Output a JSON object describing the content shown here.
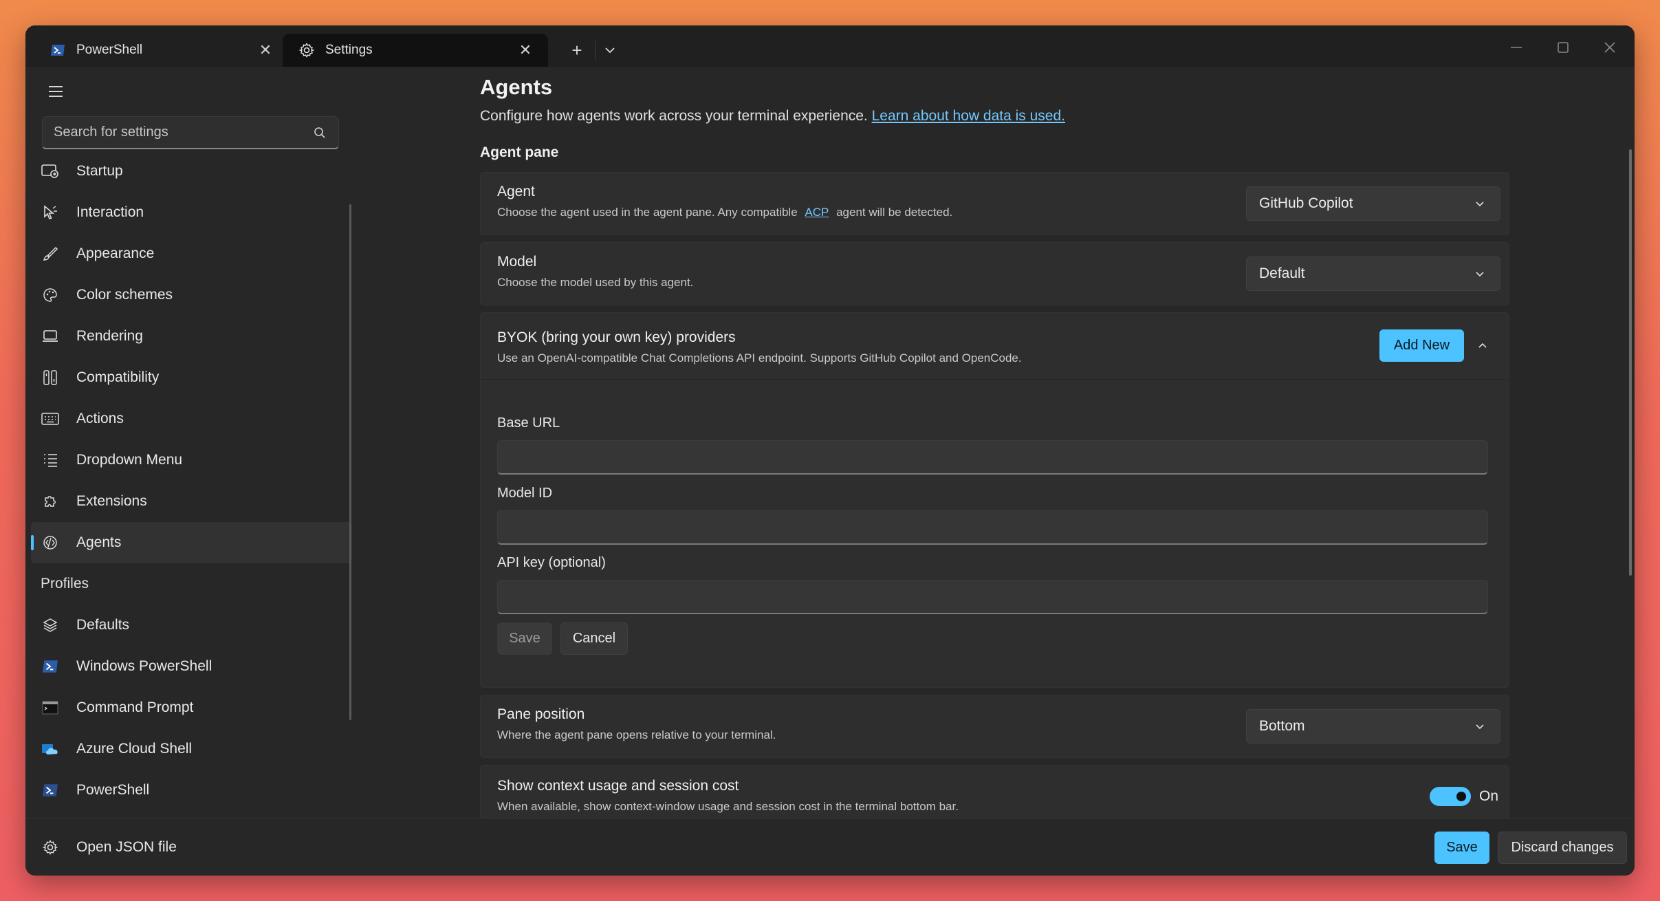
{
  "tabs": [
    {
      "label": "PowerShell",
      "icon": "powershell-icon"
    },
    {
      "label": "Settings",
      "icon": "gear-icon"
    }
  ],
  "tab_actions": {
    "new_tab": "+",
    "dropdown": "chevron-down-icon"
  },
  "window_controls": {
    "minimize": "minimize-icon",
    "maximize": "maximize-icon",
    "close": "close-icon"
  },
  "sidebar": {
    "search_placeholder": "Search for settings",
    "items": [
      {
        "label": "Startup",
        "icon": "startup-icon"
      },
      {
        "label": "Interaction",
        "icon": "cursor-icon"
      },
      {
        "label": "Appearance",
        "icon": "brush-icon"
      },
      {
        "label": "Color schemes",
        "icon": "palette-icon"
      },
      {
        "label": "Rendering",
        "icon": "monitor-icon"
      },
      {
        "label": "Compatibility",
        "icon": "compatibility-icon"
      },
      {
        "label": "Actions",
        "icon": "keyboard-icon"
      },
      {
        "label": "Dropdown Menu",
        "icon": "list-icon"
      },
      {
        "label": "Extensions",
        "icon": "puzzle-icon"
      },
      {
        "label": "Agents",
        "icon": "agent-icon",
        "active": true
      }
    ],
    "profiles_header": "Profiles",
    "profiles": [
      {
        "label": "Defaults",
        "icon": "layers-icon"
      },
      {
        "label": "Windows PowerShell",
        "icon": "powershell-icon"
      },
      {
        "label": "Command Prompt",
        "icon": "cmd-icon"
      },
      {
        "label": "Azure Cloud Shell",
        "icon": "azure-icon"
      },
      {
        "label": "PowerShell",
        "icon": "powershell-icon"
      }
    ],
    "open_json": "Open JSON file"
  },
  "main": {
    "title": "Agents",
    "description": "Configure how agents work across your terminal experience.",
    "description_link": "Learn about how data is used.",
    "section": "Agent pane",
    "agent": {
      "title": "Agent",
      "desc_before": "Choose the agent used in the agent pane. Any compatible",
      "desc_link": "ACP",
      "desc_after": "agent will be detected.",
      "value": "GitHub Copilot"
    },
    "model": {
      "title": "Model",
      "desc": "Choose the model used by this agent.",
      "value": "Default"
    },
    "byok": {
      "title": "BYOK (bring your own key) providers",
      "desc": "Use an OpenAI-compatible Chat Completions API endpoint. Supports GitHub Copilot and OpenCode.",
      "add_button": "Add New",
      "base_url_label": "Base URL",
      "base_url_value": "",
      "model_id_label": "Model ID",
      "model_id_value": "",
      "api_key_label": "API key (optional)",
      "api_key_value": "",
      "save": "Save",
      "cancel": "Cancel"
    },
    "pane_position": {
      "title": "Pane position",
      "desc": "Where the agent pane opens relative to your terminal.",
      "value": "Bottom"
    },
    "context_usage": {
      "title": "Show context usage and session cost",
      "desc": "When available, show context-window usage and session cost in the terminal bottom bar.",
      "state": "On"
    }
  },
  "footer": {
    "save": "Save",
    "discard": "Discard changes"
  },
  "colors": {
    "accent": "#4cc2ff",
    "window_bg": "#272727",
    "card_bg": "#2e2e2e"
  }
}
